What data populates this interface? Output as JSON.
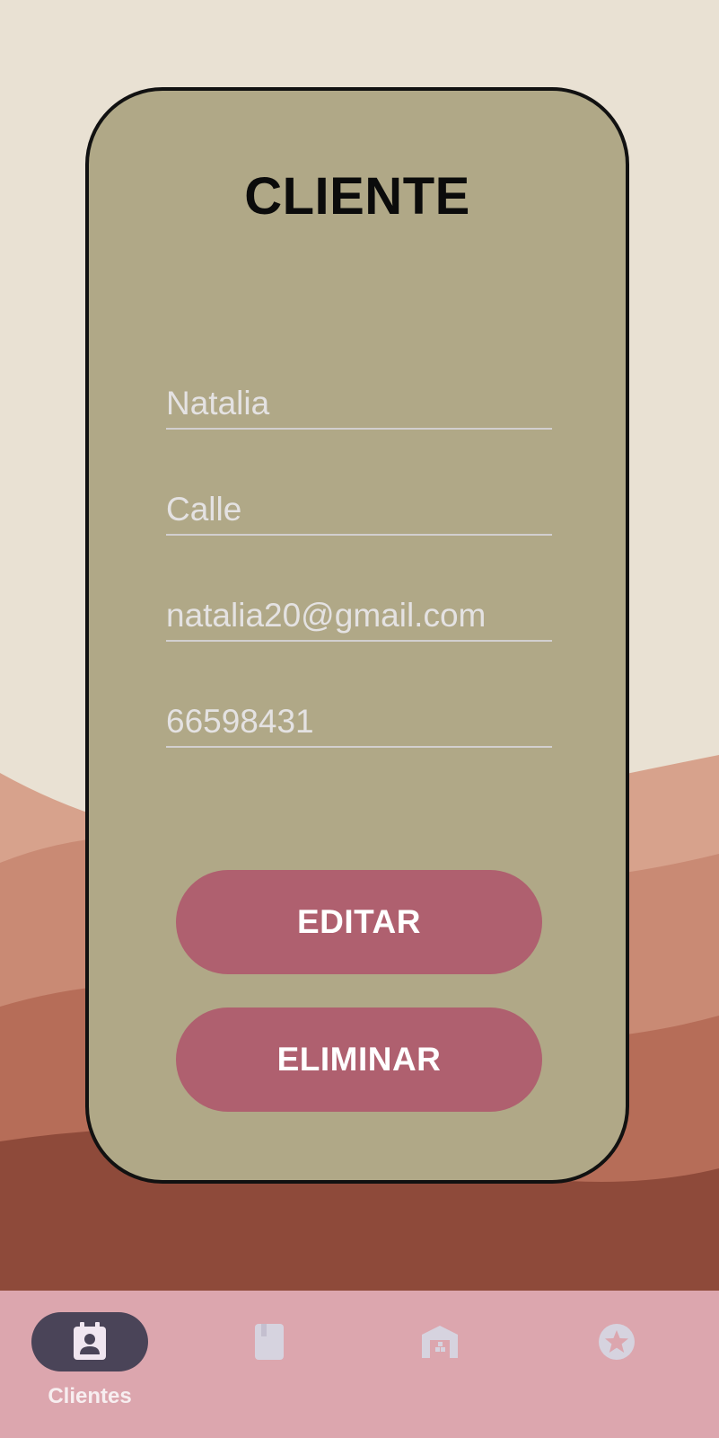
{
  "form": {
    "title": "CLIENTE",
    "fields": [
      {
        "value": "Natalia"
      },
      {
        "value": "Calle"
      },
      {
        "value": "natalia20@gmail.com"
      },
      {
        "value": "66598431"
      }
    ],
    "edit_label": "EDITAR",
    "delete_label": "ELIMINAR"
  },
  "nav": {
    "items": [
      {
        "label": "Clientes",
        "icon": "contact-calendar-icon",
        "active": true
      },
      {
        "label": "",
        "icon": "book-icon",
        "active": false
      },
      {
        "label": "",
        "icon": "warehouse-icon",
        "active": false
      },
      {
        "label": "",
        "icon": "star-badge-icon",
        "active": false
      }
    ]
  },
  "colors": {
    "card": "#b0a887",
    "button": "#af606f",
    "nav_bar": "#dca6ae",
    "nav_active_pill": "#4a4458"
  }
}
